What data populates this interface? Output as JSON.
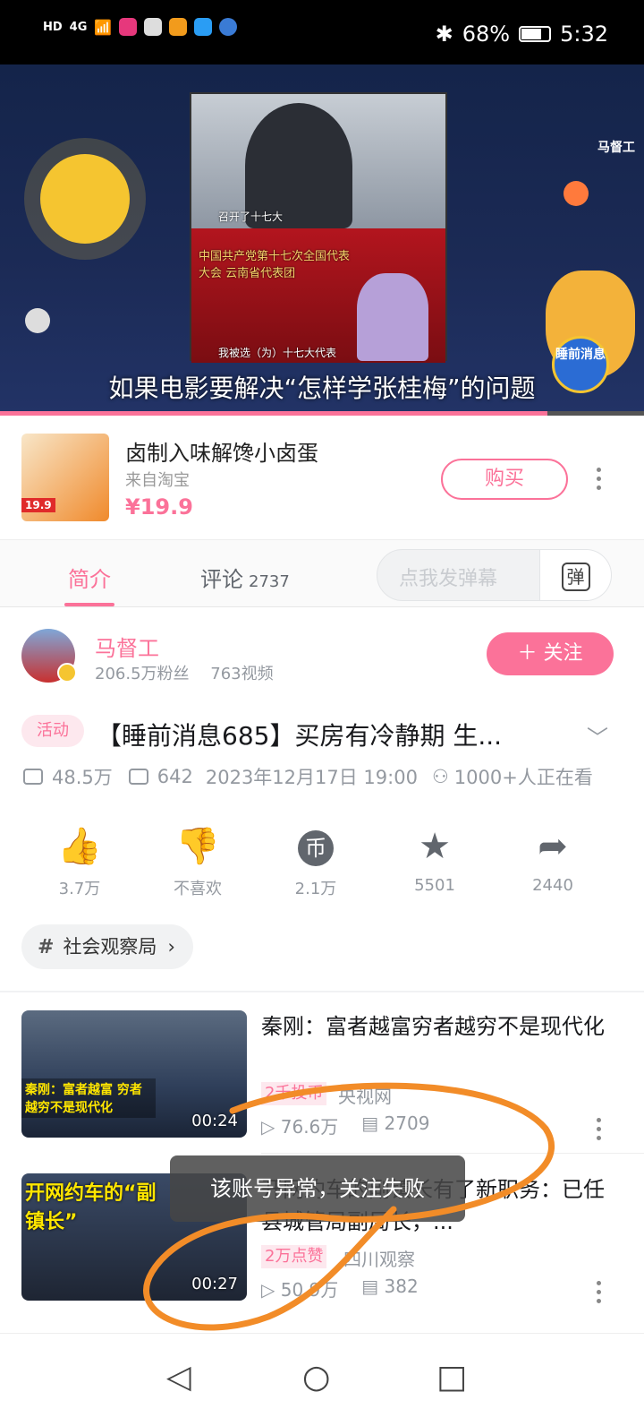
{
  "status_bar": {
    "network_left": "HD",
    "signal": "4G",
    "battery": "68%",
    "time": "5:32"
  },
  "video": {
    "channel_logo": "马督工",
    "subtitle": "如果电影要解决“怎样学张桂梅”的问题",
    "news_caption_top": "召开了十七大",
    "news_caption_bottom": "我被选（为）十七大代表",
    "news_banner": "中国共产党第十七次全国代表大会 云南省代表团",
    "badge_text": "睡前消息",
    "progress": 0.85
  },
  "product": {
    "title": "卤制入味解馋小卤蛋",
    "source": "来自淘宝",
    "price": "¥19.9",
    "image_tag": "19.9",
    "buy_label": "购买"
  },
  "tabs": {
    "intro": "简介",
    "comments": "评论",
    "comments_count": "2737",
    "danmaku_placeholder": "点我发弹幕",
    "danmaku_button": "弹"
  },
  "uploader": {
    "name": "马督工",
    "followers": "206.5万粉丝",
    "videos": "763视频",
    "follow_label": "＋ 关注"
  },
  "video_info": {
    "activity_badge": "活动",
    "title": "【睡前消息685】买房有冷静期 生...",
    "views": "48.5万",
    "danmaku_count": "642",
    "datetime": "2023年12月17日 19:00",
    "watching": "1000+人正在看"
  },
  "actions": [
    {
      "icon": "thumbs-up-icon",
      "label": "3.7万"
    },
    {
      "icon": "thumbs-down-icon",
      "label": "不喜欢"
    },
    {
      "icon": "coin-icon",
      "label": "2.1万"
    },
    {
      "icon": "star-icon",
      "label": "5501"
    },
    {
      "icon": "share-icon",
      "label": "2440"
    }
  ],
  "tag": {
    "label": "社会观察局"
  },
  "recommended": [
    {
      "title": "秦刚：富者越富穷者越穷不是现代化",
      "thumb_caption": "秦刚：富者越富 穷者越穷不是现代化",
      "duration": "00:24",
      "badge": "2千投币",
      "source": "央视网",
      "views": "76.6万",
      "danmaku": "2709"
    },
    {
      "title": "开网约车的副镇长有了新职务：已任县城管局副局长，...",
      "thumb_caption": "开网约车的“副镇长”",
      "duration": "00:27",
      "badge": "2万点赞",
      "source": "四川观察",
      "views": "50.9万",
      "danmaku": "382"
    }
  ],
  "toast": "该账号异常，关注失败",
  "colors": {
    "accent": "#fb7299",
    "annotation": "#f28c28",
    "status_bar": "#000000"
  }
}
